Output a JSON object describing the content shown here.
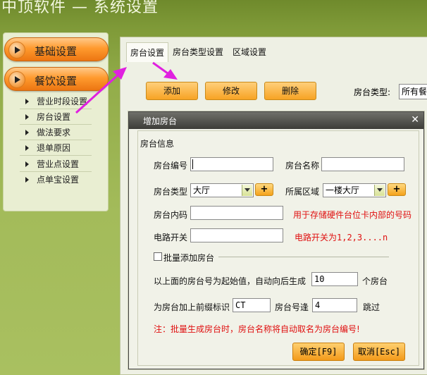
{
  "app": {
    "title": "中顶软件 — 系统设置"
  },
  "sidebar": {
    "main_items": [
      {
        "label": "基础设置"
      },
      {
        "label": "餐饮设置"
      }
    ],
    "sub_items": [
      {
        "label": "营业时段设置"
      },
      {
        "label": "房台设置"
      },
      {
        "label": "做法要求"
      },
      {
        "label": "退单原因"
      },
      {
        "label": "营业点设置"
      },
      {
        "label": "点单宝设置"
      }
    ]
  },
  "tabs": [
    {
      "label": "房台设置"
    },
    {
      "label": "房台类型设置"
    },
    {
      "label": "区域设置"
    }
  ],
  "toolbar": {
    "add": "添加",
    "edit": "修改",
    "delete": "删除",
    "room_type_label": "房台类型:",
    "room_type_value": "所有餐"
  },
  "dialog": {
    "title": "增加房台",
    "close": "✕",
    "group_title": "房台信息",
    "room_no_label": "房台编号",
    "room_no_value": "",
    "room_name_label": "房台名称",
    "room_name_value": "",
    "room_type_label": "房台类型",
    "room_type_value": "大厅",
    "area_label": "所属区域",
    "area_value": "一楼大厅",
    "plus": "+",
    "inner_code_label": "房台内码",
    "inner_code_value": "",
    "inner_code_hint": "用于存储硬件台位卡内部的号码",
    "circuit_label": "电路开关",
    "circuit_value": "",
    "circuit_hint": "电路开关为1,2,3....n",
    "batch_label": "批量添加房台",
    "batch_text": "以上面的房台号为起始值，自动向后生成",
    "batch_count": "10",
    "batch_unit": "个房台",
    "prefix_label": "为房台加上前缀标识",
    "prefix_value": "CT",
    "skip_label": "房台号逢",
    "skip_value": "4",
    "skip_suffix": "跳过",
    "note": "注：批量生成房台时，房台名称将自动取名为房台编号!",
    "ok": "确定[F9]",
    "cancel": "取消[Esc]"
  },
  "colors": {
    "accent_orange": "#f7a324",
    "arrow": "#e020e0",
    "hint_red": "#e01010",
    "background_green": "#93ad4a"
  }
}
